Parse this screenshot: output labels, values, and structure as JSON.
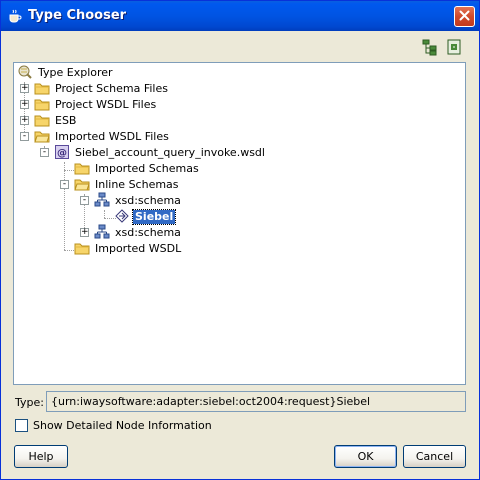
{
  "window": {
    "title": "Type Chooser",
    "close_icon": "close-icon",
    "app_icon": "coffee-cup-icon"
  },
  "toolbar": {
    "icons": [
      "tree-expand-icon",
      "import-schema-icon"
    ]
  },
  "tree": {
    "root": "Type Explorer",
    "items": [
      {
        "label": "Project Schema Files",
        "icon": "folder-icon",
        "expander": "+"
      },
      {
        "label": "Project WSDL Files",
        "icon": "folder-icon",
        "expander": "+"
      },
      {
        "label": "ESB",
        "icon": "folder-icon",
        "expander": "+"
      },
      {
        "label": "Imported WSDL Files",
        "icon": "folder-icon",
        "expander": "-"
      },
      {
        "label": "Siebel_account_query_invoke.wsdl",
        "icon": "wsdl-icon",
        "expander": "-"
      },
      {
        "label": "Imported Schemas",
        "icon": "folder-icon"
      },
      {
        "label": "Inline Schemas",
        "icon": "folder-icon",
        "expander": "-"
      },
      {
        "label": "xsd:schema",
        "icon": "schema-icon",
        "expander": "-"
      },
      {
        "label": "Siebel",
        "icon": "element-icon",
        "selected": true
      },
      {
        "label": "xsd:schema",
        "icon": "schema-icon",
        "expander": "+"
      },
      {
        "label": "Imported WSDL",
        "icon": "folder-icon"
      }
    ]
  },
  "type_field": {
    "label": "Type:",
    "value": "{urn:iwaysoftware:adapter:siebel:oct2004:request}Siebel"
  },
  "checkbox": {
    "label": "Show Detailed Node Information",
    "checked": false
  },
  "buttons": {
    "help": "Help",
    "ok": "OK",
    "cancel": "Cancel"
  }
}
